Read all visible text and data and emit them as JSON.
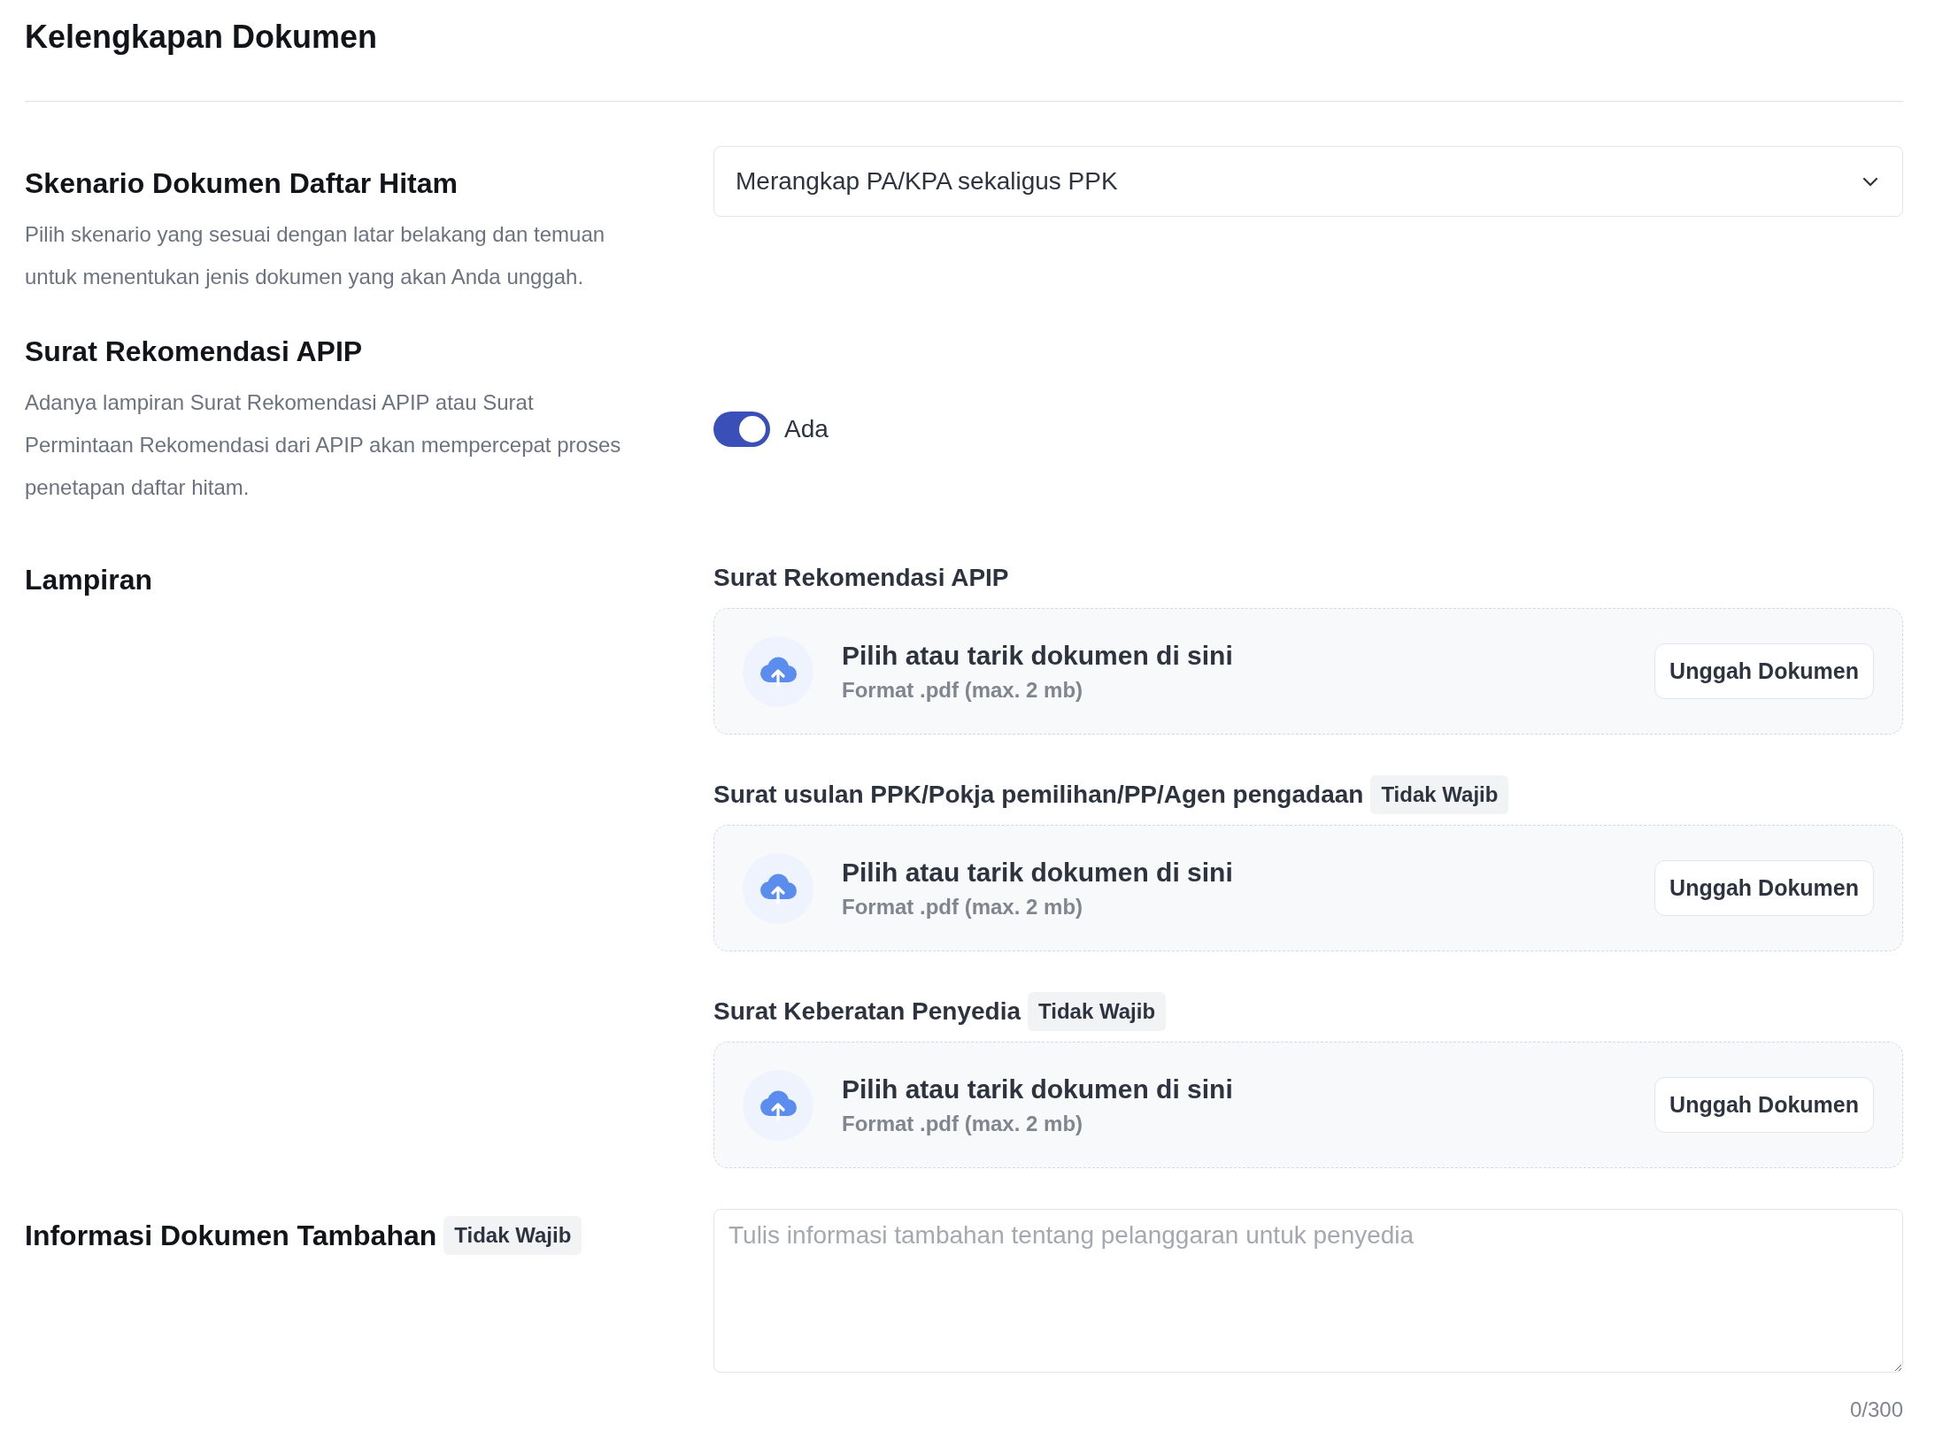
{
  "title": "Kelengkapan Dokumen",
  "scenario": {
    "title": "Skenario Dokumen Daftar Hitam",
    "description": "Pilih skenario yang sesuai dengan latar belakang dan temuan untuk menentukan jenis dokumen yang akan Anda unggah.",
    "select": {
      "value": "Merangkap PA/KPA sekaligus PPK"
    }
  },
  "recommendation": {
    "title": "Surat Rekomendasi APIP",
    "description": "Adanya lampiran Surat Rekomendasi APIP atau Surat Permintaan Rekomendasi dari APIP akan mempercepat proses penetapan daftar hitam.",
    "toggle": {
      "on": true,
      "label": "Ada"
    }
  },
  "attachments": {
    "title": "Lampiran",
    "items": [
      {
        "label": "Surat Rekomendasi APIP",
        "upload": {
          "prompt": "Pilih atau tarik dokumen di sini",
          "hint": "Format .pdf (max. 2 mb)",
          "button": "Unggah Dokumen"
        }
      },
      {
        "label": "Surat usulan PPK/Pokja pemilihan/PP/Agen pengadaan",
        "badge": "Tidak Wajib",
        "upload": {
          "prompt": "Pilih atau tarik dokumen di sini",
          "hint": "Format .pdf (max. 2 mb)",
          "button": "Unggah Dokumen"
        }
      },
      {
        "label": "Surat Keberatan Penyedia",
        "badge": "Tidak Wajib",
        "upload": {
          "prompt": "Pilih atau tarik dokumen di sini",
          "hint": "Format .pdf (max. 2 mb)",
          "button": "Unggah Dokumen"
        }
      }
    ]
  },
  "additional_info": {
    "title": "Informasi Dokumen Tambahan",
    "badge": "Tidak Wajib",
    "textarea": {
      "placeholder": "Tulis informasi tambahan tentang pelanggaran untuk penyedia"
    },
    "counter": "0/300"
  }
}
